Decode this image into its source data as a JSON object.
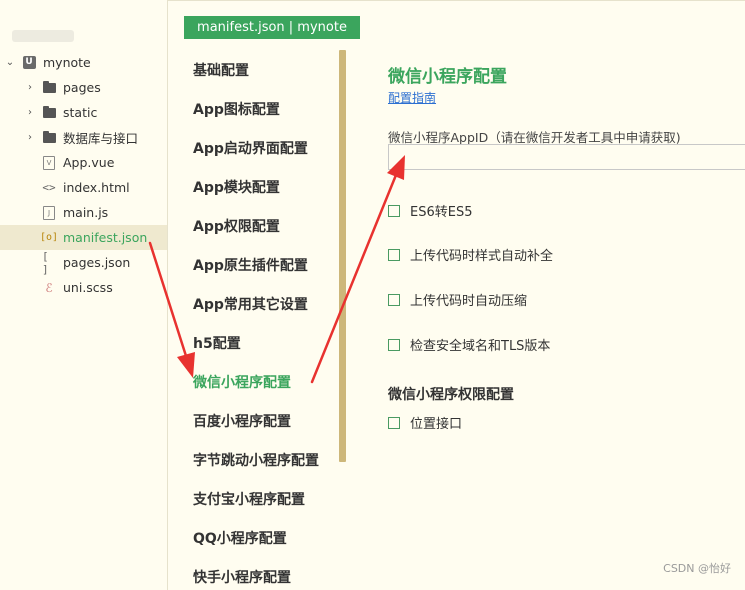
{
  "tree": {
    "project": "mynote",
    "items": [
      {
        "label": "pages",
        "icon": "folder-icon"
      },
      {
        "label": "static",
        "icon": "folder-icon"
      },
      {
        "label": "数据库与接口",
        "icon": "folder-icon"
      },
      {
        "label": "App.vue",
        "icon": "vue-file-icon"
      },
      {
        "label": "index.html",
        "icon": "code-file-icon"
      },
      {
        "label": "main.js",
        "icon": "js-file-icon"
      },
      {
        "label": "manifest.json",
        "icon": "json-file-icon",
        "selected": true
      },
      {
        "label": "pages.json",
        "icon": "bracket-file-icon"
      },
      {
        "label": "uni.scss",
        "icon": "scss-file-icon"
      }
    ]
  },
  "tab": {
    "title": "manifest.json | mynote"
  },
  "nav": {
    "items": [
      "基础配置",
      "App图标配置",
      "App启动界面配置",
      "App模块配置",
      "App权限配置",
      "App原生插件配置",
      "App常用其它设置",
      "h5配置",
      "微信小程序配置",
      "百度小程序配置",
      "字节跳动小程序配置",
      "支付宝小程序配置",
      "QQ小程序配置",
      "快手小程序配置"
    ],
    "active_index": 8
  },
  "panel": {
    "title": "微信小程序配置",
    "guide_link": "配置指南",
    "appid_label": "微信小程序AppID（请在微信开发者工具中申请获取)",
    "appid_value": "",
    "options": [
      "ES6转ES5",
      "上传代码时样式自动补全",
      "上传代码时自动压缩",
      "检查安全域名和TLS版本"
    ],
    "permissions_title": "微信小程序权限配置",
    "permissions": [
      "位置接口"
    ]
  },
  "watermark": "CSDN @怡好",
  "colors": {
    "accent": "#3ba55d",
    "arrow": "#e8322f",
    "scrollbar": "#cdb77a",
    "background": "#fffdf0"
  }
}
